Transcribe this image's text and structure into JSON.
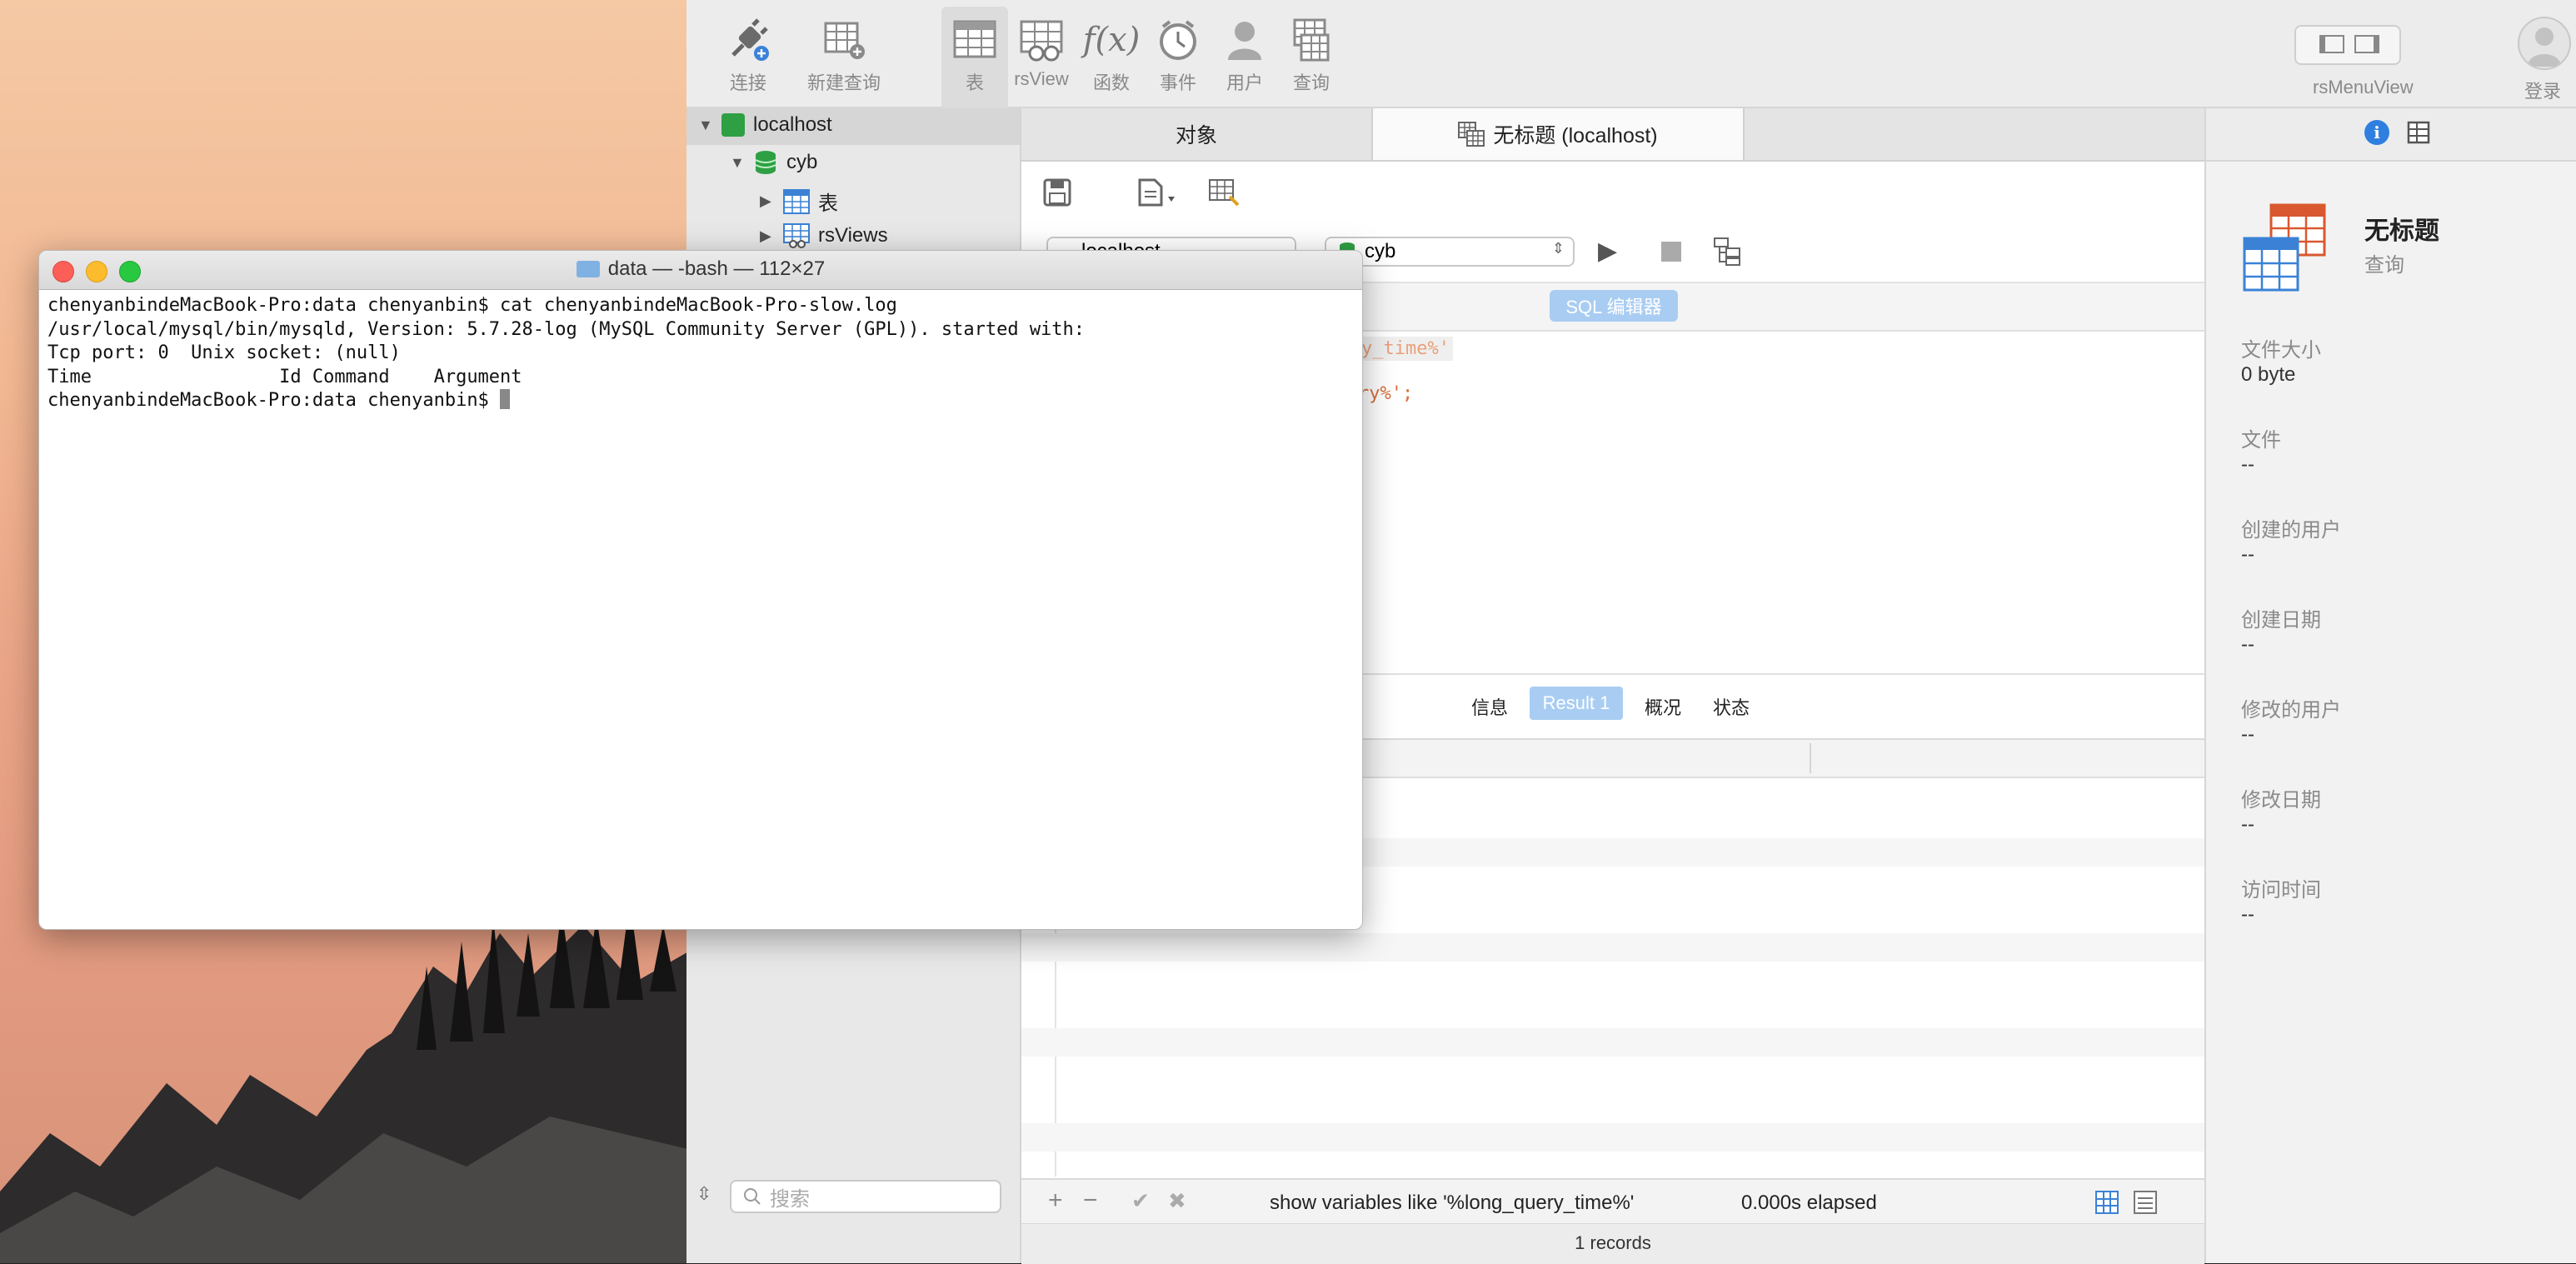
{
  "toolbar": {
    "connect": "连接",
    "new_query": "新建查询",
    "table": "表",
    "rsview": "rsView",
    "function": "函数",
    "event": "事件",
    "user": "用户",
    "query": "查询",
    "menu_view": "rsMenuView",
    "login": "登录"
  },
  "sidebar": {
    "connection": "localhost",
    "database": "cyb",
    "items": [
      {
        "label": "表"
      },
      {
        "label": "rsViews"
      }
    ],
    "search_placeholder": "搜索"
  },
  "tabs": {
    "objects": "对象",
    "query_tab": "无标题 (localhost)"
  },
  "query_bar": {
    "connection_select": "localhost",
    "database_select": "cyb",
    "sql_editor_button": "SQL 编辑器"
  },
  "editor": {
    "line1_partial": "y_time%'",
    "line2_partial": "ry%';"
  },
  "result_tabs": {
    "info": "信息",
    "result1": "Result 1",
    "overview": "概况",
    "status": "状态"
  },
  "status": {
    "sql": "show variables like '%long_query_time%'",
    "elapsed": "0.000s elapsed",
    "records": "1 records"
  },
  "right_panel": {
    "title": "无标题",
    "subtitle": "查询",
    "fields": [
      {
        "label": "文件大小",
        "value": "0 byte"
      },
      {
        "label": "文件",
        "value": "--"
      },
      {
        "label": "创建的用户",
        "value": "--"
      },
      {
        "label": "创建日期",
        "value": "--"
      },
      {
        "label": "修改的用户",
        "value": "--"
      },
      {
        "label": "修改日期",
        "value": "--"
      },
      {
        "label": "访问时间",
        "value": "--"
      }
    ]
  },
  "terminal": {
    "title": "data — -bash — 112×27",
    "lines": [
      "chenyanbindeMacBook-Pro:data chenyanbin$ cat chenyanbindeMacBook-Pro-slow.log",
      "/usr/local/mysql/bin/mysqld, Version: 5.7.28-log (MySQL Community Server (GPL)). started with:",
      "Tcp port: 0  Unix socket: (null)",
      "Time                 Id Command    Argument"
    ],
    "prompt": "chenyanbindeMacBook-Pro:data chenyanbin$ "
  }
}
